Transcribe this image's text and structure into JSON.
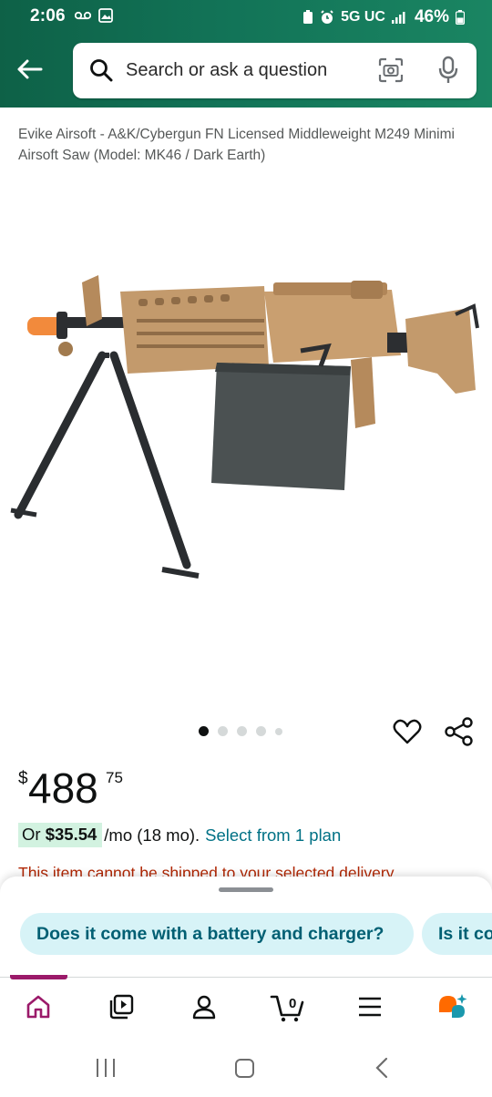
{
  "status_bar": {
    "time": "2:06",
    "network": "5G UC",
    "battery": "46%"
  },
  "search": {
    "placeholder": "Search or ask a question"
  },
  "product": {
    "title": "Evike Airsoft - A&K/Cybergun FN Licensed Middleweight M249 Minimi Airsoft Saw (Model: MK46 / Dark Earth)",
    "image_alt": "M249 airsoft machine gun with bipod",
    "carousel": {
      "count": 5,
      "active_index": 0
    },
    "price": {
      "symbol": "$",
      "whole": "488",
      "fraction": "75"
    },
    "monthly": {
      "prefix": "Or ",
      "amount": "$35.54",
      "suffix": "/mo (18 mo).",
      "link": "Select from 1 plan"
    },
    "shipping_warning": "This item cannot be shipped to your selected delivery"
  },
  "suggestions": {
    "chips": [
      "Does it come with a battery and charger?",
      "Is it co"
    ]
  },
  "bottom_nav": {
    "items": [
      {
        "name": "home",
        "icon": "home-icon"
      },
      {
        "name": "inspire",
        "icon": "inspire-icon"
      },
      {
        "name": "account",
        "icon": "person-icon"
      },
      {
        "name": "cart",
        "icon": "cart-icon",
        "badge": "0"
      },
      {
        "name": "menu",
        "icon": "menu-icon"
      },
      {
        "name": "rufus",
        "icon": "rufus-icon"
      }
    ],
    "active": "home"
  },
  "colors": {
    "header_green": "#127357",
    "link": "#007185",
    "price_pill": "#d2f2e0",
    "warning": "#b12704",
    "chip_bg": "#d7f3f7",
    "active_nav": "#9b1a6a"
  }
}
